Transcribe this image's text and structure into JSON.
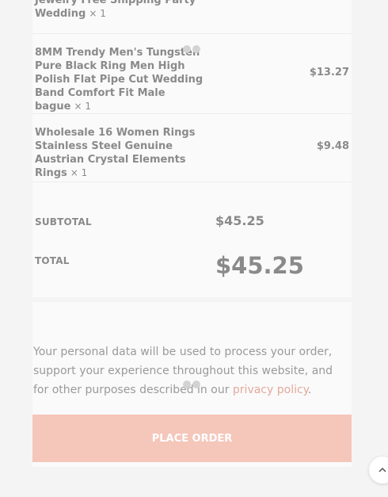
{
  "items": [
    {
      "name": "Jewelry Free Shipping Party Wedding",
      "qty": "× 1",
      "price": ""
    },
    {
      "name": "8MM Trendy Men's Tungsten Pure Black Ring Men High Polish Flat Pipe Cut Wedding Band Comfort Fit Male bague",
      "qty": "× 1",
      "price": "$13.27"
    },
    {
      "name": "Wholesale 16 Women Rings Stainless Steel Genuine Austrian Crystal Elements Rings",
      "qty": "× 1",
      "price": "$9.48"
    }
  ],
  "totals": {
    "subtotal_label": "SUBTOTAL",
    "subtotal_value": "$45.25",
    "total_label": "TOTAL",
    "total_value": "$45.25"
  },
  "privacy": {
    "text": "Your personal data will be used to process your order, support your experience throughout this website, and for other purposes described in our ",
    "link": "privacy policy",
    "end": "."
  },
  "place_order_label": "PLACE ORDER",
  "colors": {
    "accent": "#f5c6ba",
    "link": "#e3a99b"
  },
  "icons": {
    "scroll_top": "chevron-up-icon",
    "loader": "loading-dots-icon"
  }
}
